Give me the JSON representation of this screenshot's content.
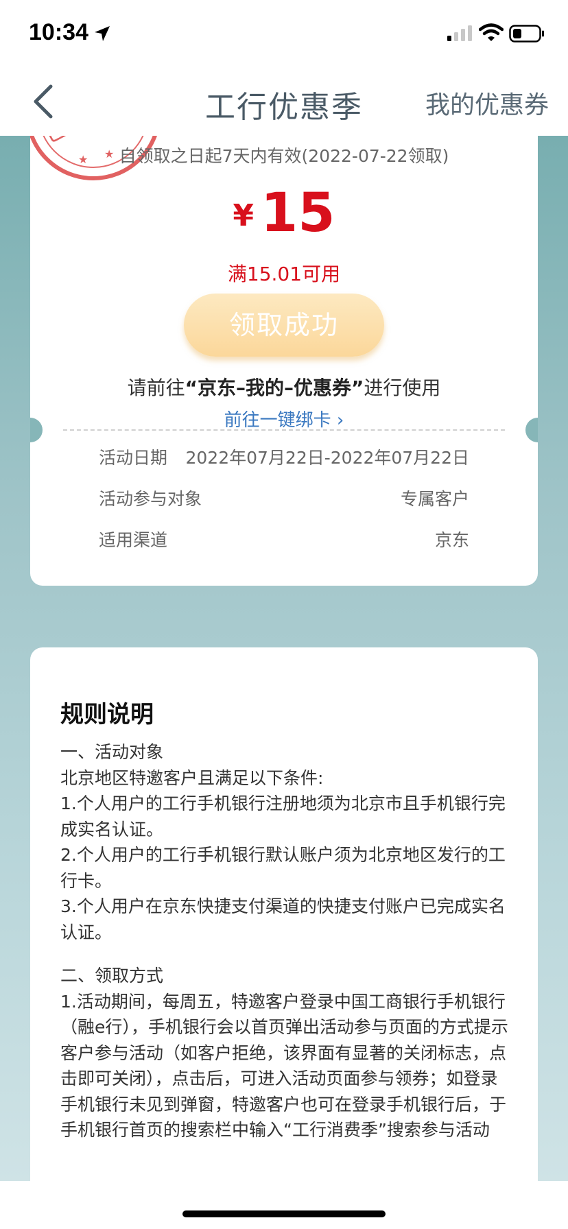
{
  "status_bar": {
    "time": "10:34",
    "icons": [
      "location-arrow-icon",
      "cellular-signal-icon",
      "wifi-icon",
      "battery-icon"
    ]
  },
  "nav": {
    "title": "工行优惠季",
    "right_label": "我的优惠券",
    "back_icon": "chevron-left-icon"
  },
  "coupon": {
    "validity": "自领取之日起7天内有效(2022-07-22领取)",
    "currency": "¥",
    "amount": "15",
    "condition": "满15.01可用",
    "claim_button": "领取成功",
    "instruction_prefix": "请前往",
    "instruction_emph": "“京东–我的–优惠券”",
    "instruction_suffix": "进行使用",
    "bind_link": "前往一键绑卡 ›",
    "info": [
      {
        "label": "活动日期",
        "value": "2022年07月22日-2022年07月22日"
      },
      {
        "label": "活动参与对象",
        "value": "专属客户"
      },
      {
        "label": "适用渠道",
        "value": "京东"
      }
    ]
  },
  "rules": {
    "title": "规则说明",
    "section1_heading": "一、活动对象",
    "section1_intro": "北京地区特邀客户且满足以下条件:",
    "section1_item1": "1.个人用户的工行手机银行注册地须为北京市且手机银行完成实名认证。",
    "section1_item2": "2.个人用户的工行手机银行默认账户须为北京地区发行的工行卡。",
    "section1_item3": "3.个人用户在京东快捷支付渠道的快捷支付账户已完成实名认证。",
    "section2_heading": "二、领取方式",
    "section2_item1": "1.活动期间，每周五，特邀客户登录中国工商银行手机银行（融e行），手机银行会以首页弹出活动参与页面的方式提示客户参与活动（如客户拒绝，该界面有显著的关闭标志，点击即可关闭），点击后，可进入活动页面参与领券；如登录手机银行未见到弹窗，特邀客户也可在登录手机银行后，于手机银行首页的搜索栏中输入“工行消费季”搜索参与活动"
  },
  "colors": {
    "accent_red": "#d8101c",
    "link_blue": "#3a78c0",
    "teal_bg": "#78aeb0",
    "button_gold": "#fbd79a"
  }
}
